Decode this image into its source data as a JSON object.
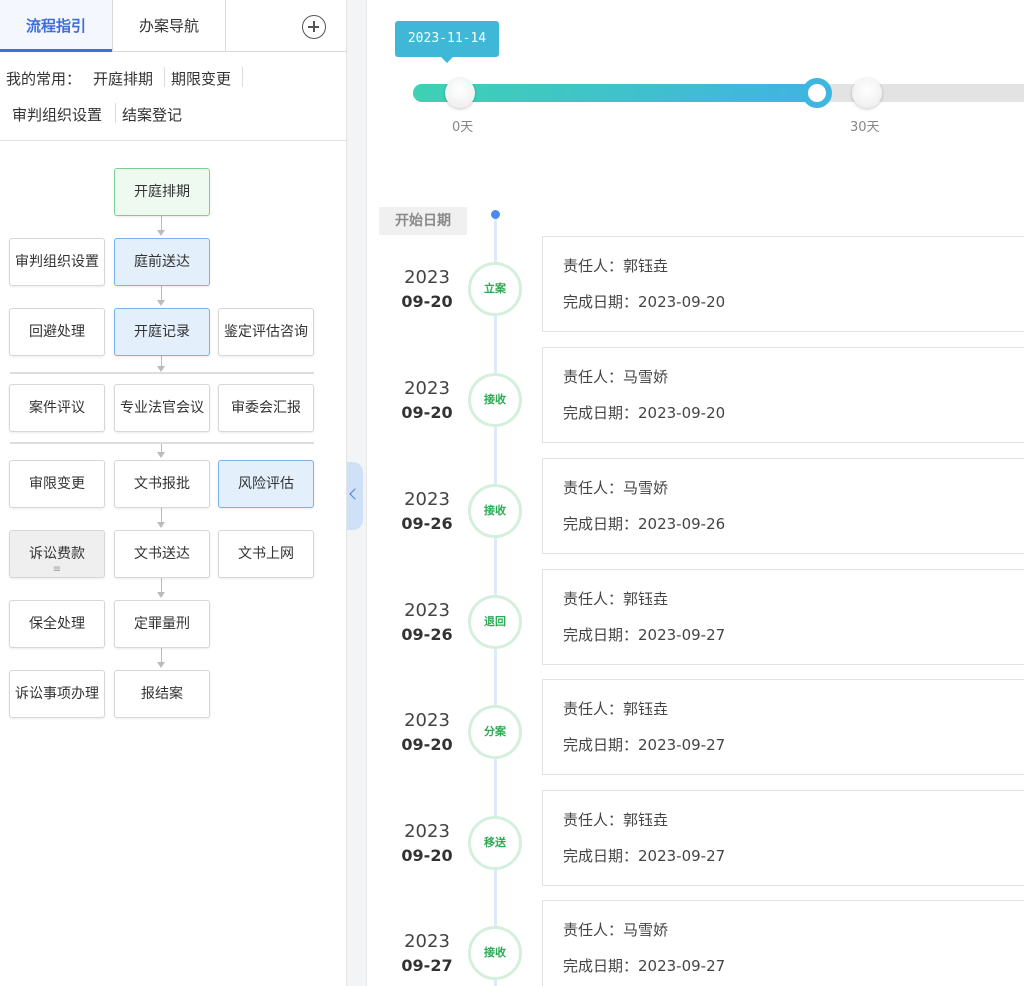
{
  "tabs": [
    {
      "label": "流程指引",
      "active": true
    },
    {
      "label": "办案导航",
      "active": false
    }
  ],
  "favorites": {
    "label": "我的常用：",
    "items": [
      "开庭排期",
      "期限变更",
      "审判组织设置",
      "结案登记"
    ]
  },
  "flow": {
    "nodes": [
      {
        "id": "kaiting-paiqi",
        "label": "开庭排期",
        "state": "done"
      },
      {
        "id": "shenpan-zuzhi",
        "label": "审判组织设置",
        "state": "normal"
      },
      {
        "id": "tingqian-songda",
        "label": "庭前送达",
        "state": "current"
      },
      {
        "id": "huibi",
        "label": "回避处理",
        "state": "normal"
      },
      {
        "id": "kaiting-jilu",
        "label": "开庭记录",
        "state": "current"
      },
      {
        "id": "jianding",
        "label": "鉴定评估咨询",
        "state": "normal"
      },
      {
        "id": "anjian-pingyi",
        "label": "案件评议",
        "state": "normal"
      },
      {
        "id": "zhuanye-faguan",
        "label": "专业法官会议",
        "state": "normal"
      },
      {
        "id": "shenwei-hui",
        "label": "审委会汇报",
        "state": "normal"
      },
      {
        "id": "shenxian-biangeng",
        "label": "审限变更",
        "state": "normal"
      },
      {
        "id": "wenshu-baopi",
        "label": "文书报批",
        "state": "normal"
      },
      {
        "id": "fengxian-pinggu",
        "label": "风险评估",
        "state": "current"
      },
      {
        "id": "susong-feikuan",
        "label": "诉讼费款",
        "state": "disabled"
      },
      {
        "id": "wenshu-songda",
        "label": "文书送达",
        "state": "normal"
      },
      {
        "id": "wenshu-shangwang",
        "label": "文书上网",
        "state": "normal"
      },
      {
        "id": "baoquan",
        "label": "保全处理",
        "state": "normal"
      },
      {
        "id": "dingzui",
        "label": "定罪量刑",
        "state": "normal"
      },
      {
        "id": "susong-shixiang",
        "label": "诉讼事项办理",
        "state": "normal"
      },
      {
        "id": "baojiean",
        "label": "报结案",
        "state": "normal"
      }
    ]
  },
  "slider": {
    "tooltip": "2023-11-14",
    "labels": [
      "0天",
      "30天"
    ],
    "progress_days": 27.8
  },
  "timeline": {
    "start_label": "开始日期",
    "entries": [
      {
        "year": "2023",
        "md": "09-20",
        "action": "立案",
        "person_text": "责任人：郭钰垚",
        "date_text": "完成日期：2023-09-20"
      },
      {
        "year": "2023",
        "md": "09-20",
        "action": "接收",
        "person_text": "责任人：马雪娇",
        "date_text": "完成日期：2023-09-20"
      },
      {
        "year": "2023",
        "md": "09-26",
        "action": "接收",
        "person_text": "责任人：马雪娇",
        "date_text": "完成日期：2023-09-26"
      },
      {
        "year": "2023",
        "md": "09-26",
        "action": "退回",
        "person_text": "责任人：郭钰垚",
        "date_text": "完成日期：2023-09-27"
      },
      {
        "year": "2023",
        "md": "09-20",
        "action": "分案",
        "person_text": "责任人：郭钰垚",
        "date_text": "完成日期：2023-09-27"
      },
      {
        "year": "2023",
        "md": "09-20",
        "action": "移送",
        "person_text": "责任人：郭钰垚",
        "date_text": "完成日期：2023-09-27"
      },
      {
        "year": "2023",
        "md": "09-27",
        "action": "接收",
        "person_text": "责任人：马雪娇",
        "date_text": "完成日期：2023-09-27"
      }
    ]
  },
  "colors": {
    "accent_blue": "#3c6fd9",
    "slider_start": "#3ed1b3",
    "slider_end": "#41b3e2",
    "badge_green": "#2daa55"
  }
}
